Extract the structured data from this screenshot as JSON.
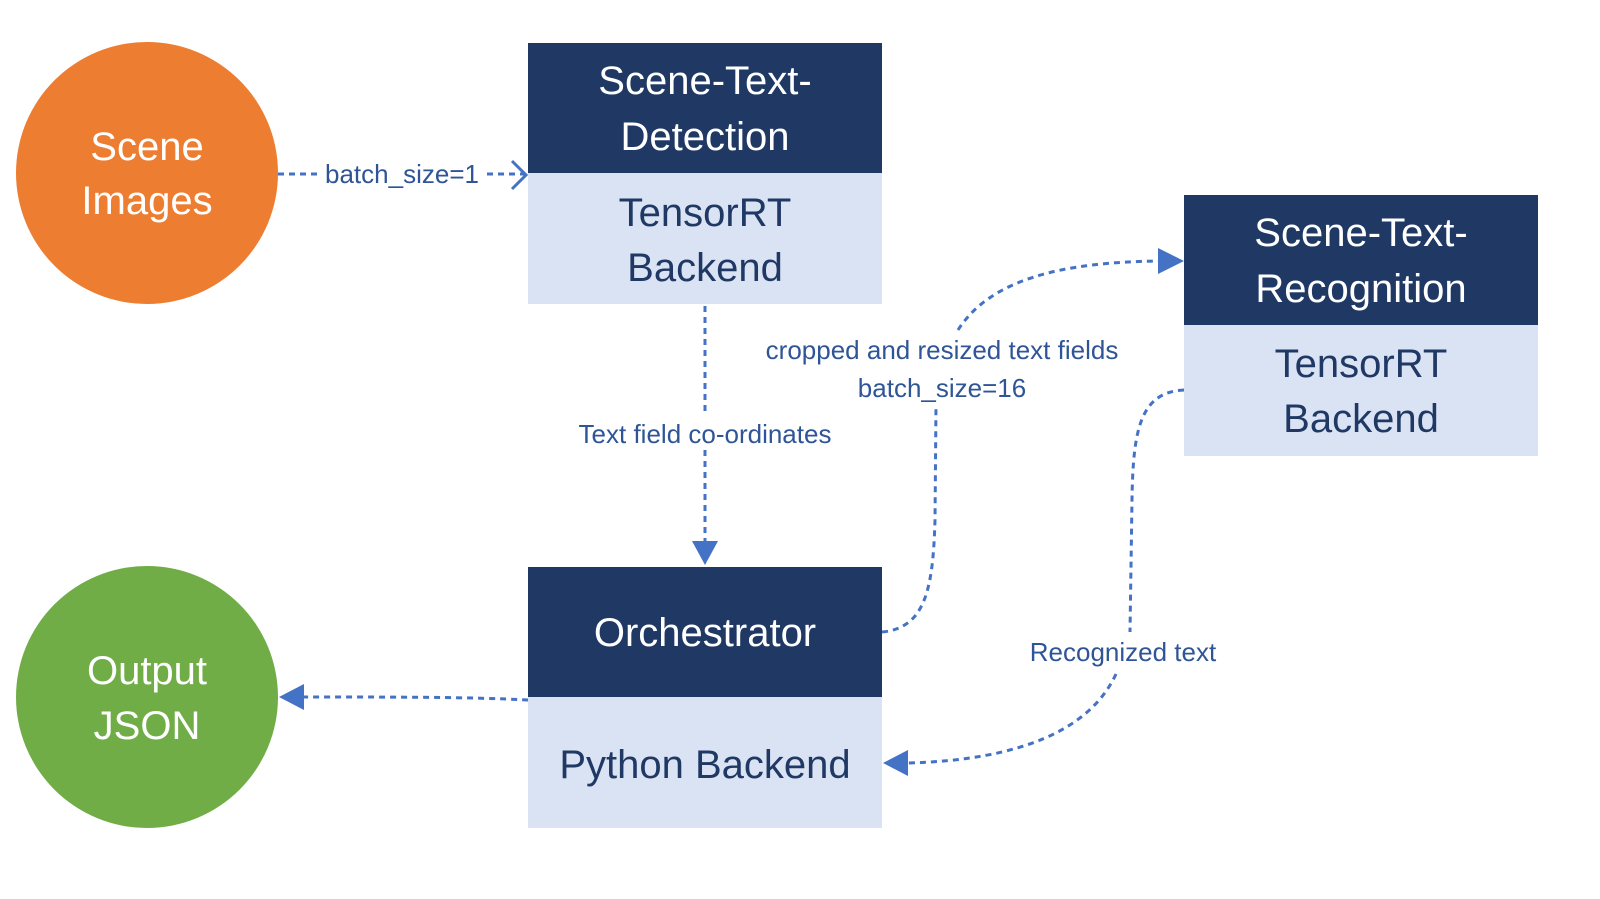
{
  "colors": {
    "header": "#1F3864",
    "body": "#DAE3F3",
    "source": "#ED7D31",
    "sink": "#70AD47",
    "edge": "#4472C4"
  },
  "nodes": {
    "scene_images": {
      "lines": [
        "Scene",
        "Images"
      ]
    },
    "output_json": {
      "lines": [
        "Output",
        "JSON"
      ]
    },
    "detection": {
      "title": [
        "Scene-Text-",
        "Detection"
      ],
      "backend": [
        "TensorRT",
        "Backend"
      ]
    },
    "recognition": {
      "title": [
        "Scene-Text-",
        "Recognition"
      ],
      "backend": [
        "TensorRT",
        "Backend"
      ]
    },
    "orchestrator": {
      "title": [
        "Orchestrator"
      ],
      "backend": [
        "Python Backend"
      ]
    }
  },
  "edges": {
    "images_to_detection": "batch_size=1",
    "detection_to_orchestrator": "Text field co-ordinates",
    "orchestrator_to_recognition": [
      "cropped and resized text fields",
      "batch_size=16"
    ],
    "recognition_to_orchestrator": "Recognized text"
  }
}
